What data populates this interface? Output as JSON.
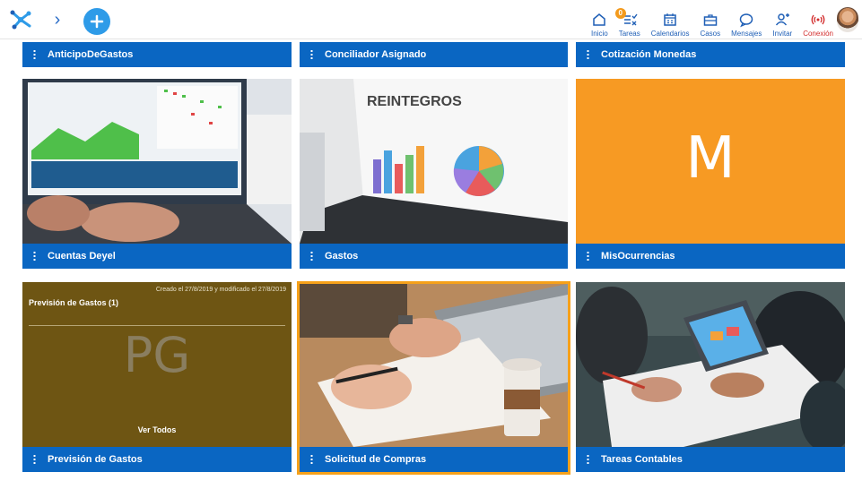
{
  "header": {
    "nav": [
      {
        "label": "Inicio",
        "icon": "home-icon"
      },
      {
        "label": "Tareas",
        "icon": "tasks-icon",
        "badge": "0"
      },
      {
        "label": "Calendarios",
        "icon": "calendar-icon"
      },
      {
        "label": "Casos",
        "icon": "briefcase-icon"
      },
      {
        "label": "Mensajes",
        "icon": "message-icon"
      },
      {
        "label": "Invitar",
        "icon": "invite-icon"
      },
      {
        "label": "Conexión",
        "icon": "connection-icon"
      }
    ]
  },
  "tiles_top": [
    {
      "title": "AnticipoDeGastos"
    },
    {
      "title": "Conciliador Asignado"
    },
    {
      "title": "Cotización Monedas"
    }
  ],
  "tiles_middle": [
    {
      "title": "Cuentas Deyel"
    },
    {
      "title": "Gastos",
      "image_text": "REINTEGROS"
    },
    {
      "title": "MisOcurrencias",
      "letter": "M"
    }
  ],
  "tiles_bottom": [
    {
      "title": "Previsión de Gastos",
      "card_title": "Previsión de Gastos (1)",
      "meta": "Creado el 27/8/2019 y modificado el 27/8/2019",
      "initials": "PG",
      "link": "Ver Todos"
    },
    {
      "title": "Solicitud de Compras"
    },
    {
      "title": "Tareas Contables"
    }
  ],
  "colors": {
    "bar": "#0a66c2",
    "accent": "#f79a23",
    "olive": "#6e5513",
    "selection": "#f6a11a"
  }
}
